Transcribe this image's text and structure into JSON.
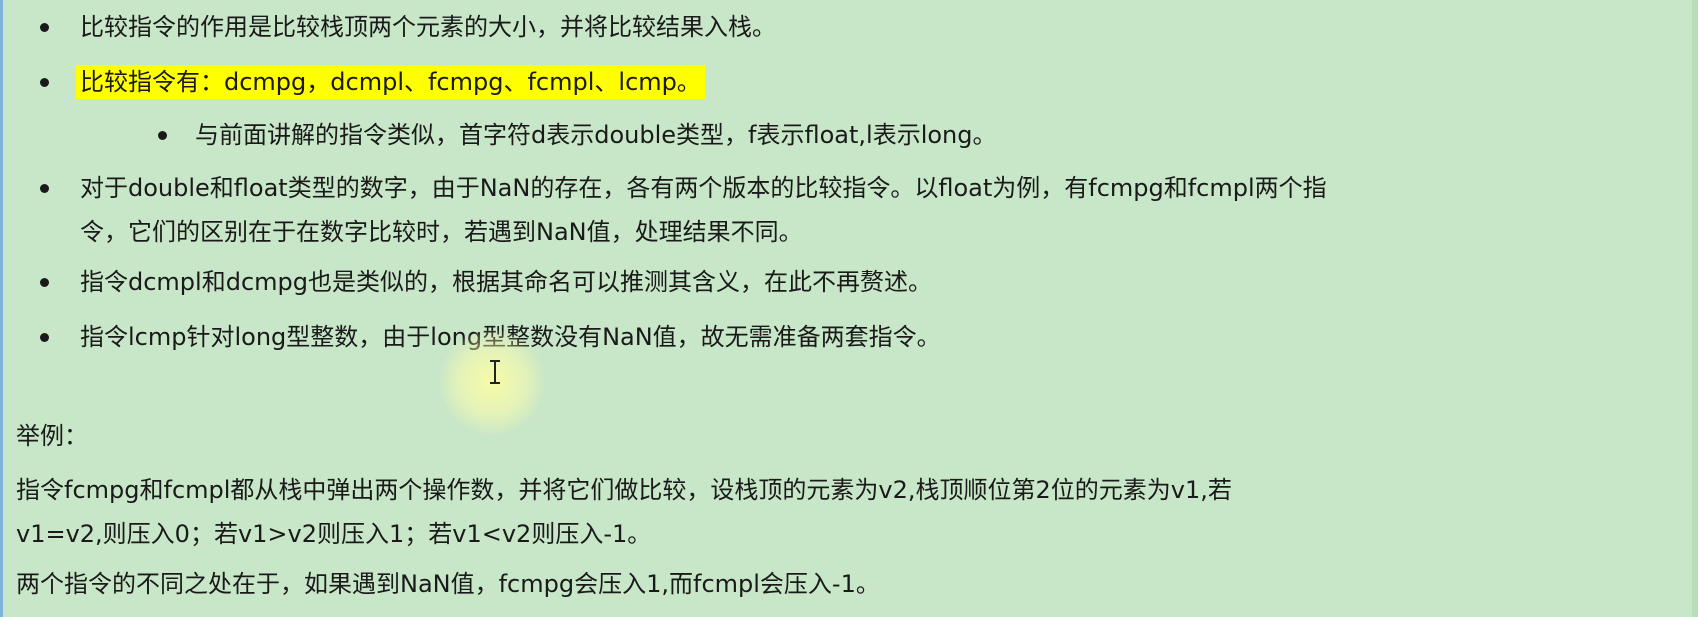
{
  "bullets": [
    "比较指令的作用是比较栈顶两个元素的大小，并将比较结果入栈。",
    "比较指令有：dcmpg，dcmpl、fcmpg、fcmpl、lcmp。",
    "与前面讲解的指令类似，首字符d表示double类型，f表示float,l表示long。",
    "对于double和float类型的数字，由于NaN的存在，各有两个版本的比较指令。以float为例，有fcmpg和fcmpl两个指",
    "令，它们的区别在于在数字比较时，若遇到NaN值，处理结果不同。",
    "指令dcmpl和dcmpg也是类似的，根据其命名可以推测其含义，在此不再赘述。",
    "指令lcmp针对long型整数，由于long型整数没有NaN值，故无需准备两套指令。"
  ],
  "example": {
    "heading": "举例：",
    "line1": "指令fcmpg和fcmpl都从栈中弹出两个操作数，并将它们做比较，设栈顶的元素为v2,栈顶顺位第2位的元素为v1,若",
    "line2": "v1=v2,则压入0；若v1>v2则压入1；若v1<v2则压入-1。",
    "line3": "两个指令的不同之处在于，如果遇到NaN值，fcmpg会压入1,而fcmpl会压入-1。"
  },
  "colors": {
    "background": "#c8e6c8",
    "highlight": "#ffff00",
    "text": "#1a1a1a"
  }
}
